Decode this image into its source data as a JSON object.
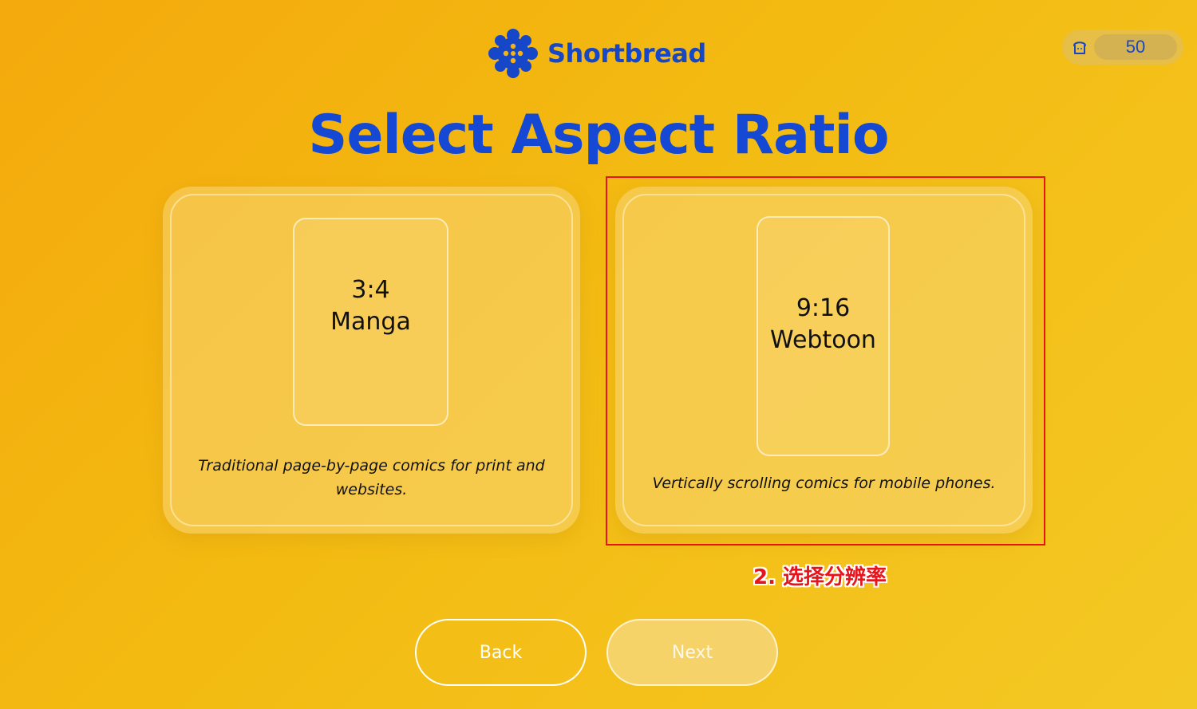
{
  "header": {
    "brand_name": "Shortbread",
    "logo_icon": "shortbread-logo-icon",
    "credits_icon": "bread-icon",
    "credits_count": "50"
  },
  "main": {
    "title": "Select Aspect Ratio",
    "options": [
      {
        "ratio": "3:4",
        "name": "Manga",
        "description": "Traditional page-by-page comics for print and websites."
      },
      {
        "ratio": "9:16",
        "name": "Webtoon",
        "description": "Vertically scrolling comics for mobile phones."
      }
    ]
  },
  "annotation": {
    "text": "2. 选择分辨率",
    "color": "#e8141b"
  },
  "footer": {
    "back_label": "Back",
    "next_label": "Next"
  },
  "colors": {
    "brand_blue": "#1549d4",
    "background_start": "#f4a90c",
    "background_end": "#f4c824"
  }
}
